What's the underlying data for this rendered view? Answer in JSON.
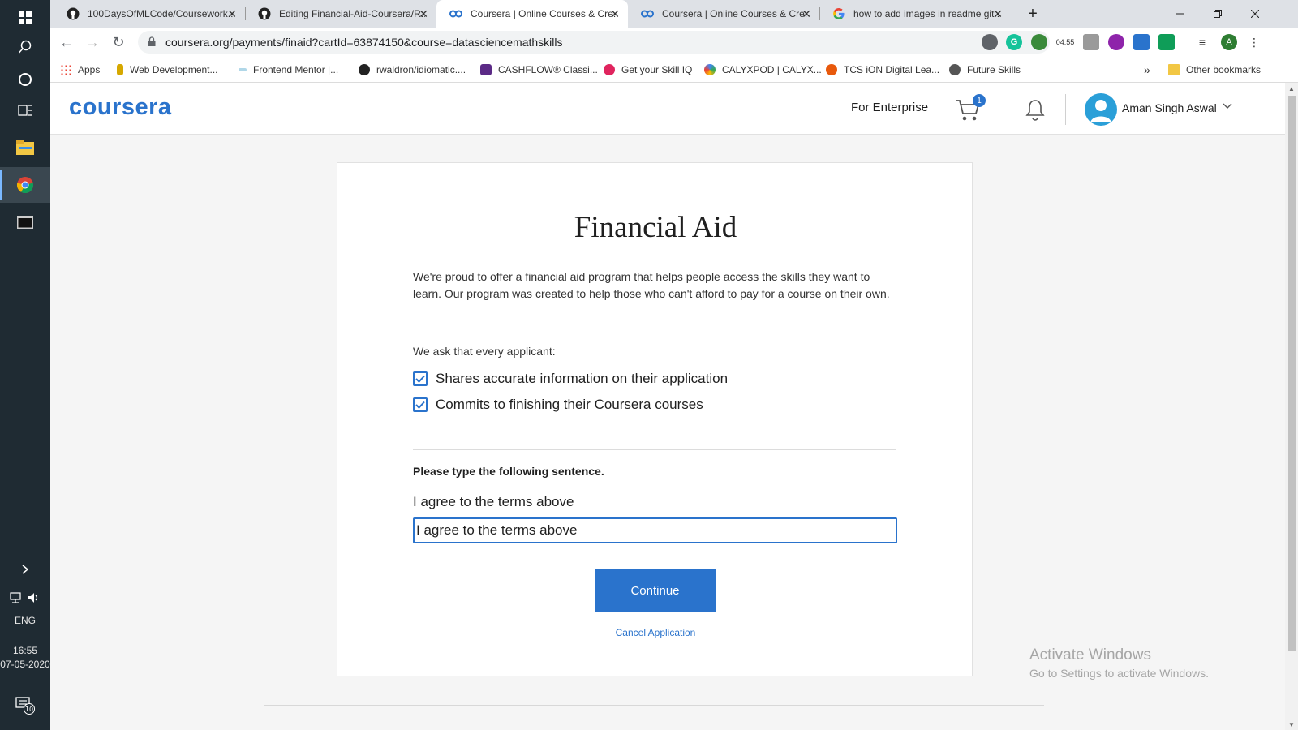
{
  "taskbar": {
    "language": "ENG",
    "time": "16:55",
    "date": "07-05-2020",
    "notification_count": "10"
  },
  "browser": {
    "tabs": [
      {
        "label": "100DaysOfMLCode/Coursework..."
      },
      {
        "label": "Editing Financial-Aid-Coursera/R..."
      },
      {
        "label": "Coursera | Online Courses & Cre..."
      },
      {
        "label": "Coursera | Online Courses & Cre..."
      },
      {
        "label": "how to add images in readme git..."
      }
    ],
    "url": "coursera.org/payments/finaid?cartId=63874150&course=datasciencemathskills",
    "extension_timer": "04:55",
    "profile_initial": "A",
    "bookmarks": [
      {
        "label": "Apps"
      },
      {
        "label": "Web Development..."
      },
      {
        "label": "Frontend Mentor |..."
      },
      {
        "label": "rwaldron/idiomatic...."
      },
      {
        "label": "CASHFLOW® Classi..."
      },
      {
        "label": "Get your Skill IQ"
      },
      {
        "label": "CALYXPOD | CALYX..."
      },
      {
        "label": "TCS iON Digital Lea..."
      },
      {
        "label": "Future Skills"
      }
    ],
    "bookmarks_overflow": "»",
    "other_bookmarks": "Other bookmarks"
  },
  "header": {
    "logo": "coursera",
    "enterprise_link": "For Enterprise",
    "cart_count": "1",
    "user_name": "Aman Singh Aswal"
  },
  "form": {
    "title": "Financial Aid",
    "intro": "We're proud to offer a financial aid program that helps people access the skills they want to learn. Our program was created to help those who can't afford to pay for a course on their own.",
    "ask": "We ask that every applicant:",
    "checks": [
      {
        "label": "Shares accurate information on their application",
        "checked": true
      },
      {
        "label": "Commits to finishing their Coursera courses",
        "checked": true
      }
    ],
    "prompt": "Please type the following sentence.",
    "sentence": "I agree to the terms above",
    "input_value": "I agree to the terms above",
    "continue_label": "Continue",
    "cancel_label": "Cancel Application"
  },
  "watermark": {
    "title": "Activate Windows",
    "subtitle": "Go to Settings to activate Windows."
  },
  "colors": {
    "brand": "#2a73cc",
    "taskbar": "#1f2b33"
  }
}
